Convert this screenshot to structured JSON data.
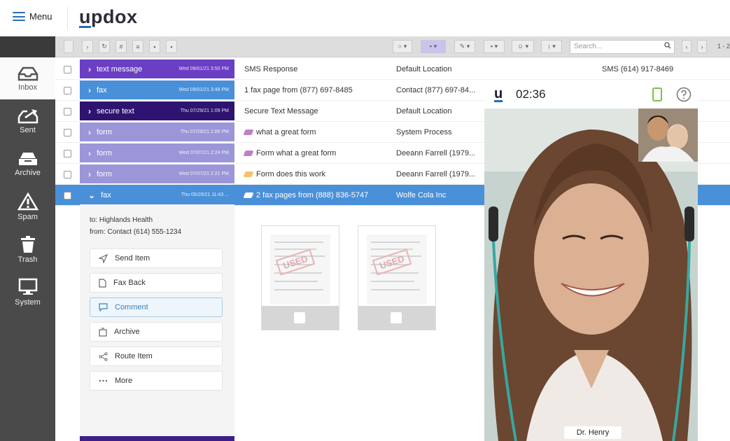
{
  "header": {
    "menu_label": "Menu",
    "logo_pre": "u",
    "logo_rest": "pdox"
  },
  "sidebar": [
    {
      "label": "Inbox",
      "icon": "inbox-icon",
      "active": true
    },
    {
      "label": "Sent",
      "icon": "sent-icon"
    },
    {
      "label": "Archive",
      "icon": "archive-icon"
    },
    {
      "label": "Spam",
      "icon": "spam-icon"
    },
    {
      "label": "Trash",
      "icon": "trash-icon"
    },
    {
      "label": "System",
      "icon": "system-icon"
    }
  ],
  "toolbar": {
    "search_placeholder": "Search...",
    "pager": "1 - 2"
  },
  "rows": [
    {
      "type": "text message",
      "date": "Wed 09/01/21 3:50 PM",
      "color": "#6a3fc4",
      "subject": "SMS Response",
      "from": "Default Location",
      "extra": "SMS (614) 917-8469",
      "tag": ""
    },
    {
      "type": "fax",
      "date": "Wed 09/01/21 3:48 PM",
      "color": "#4a90d9",
      "subject": "1 fax page from (877) 697-8485",
      "from": "Contact (877) 697-84...",
      "extra": "",
      "tag": ""
    },
    {
      "type": "secure text",
      "date": "Thu 07/29/21 1:09 PM",
      "color": "#2e1470",
      "subject": "Secure Text Message",
      "from": "Default Location",
      "extra": "",
      "tag": ""
    },
    {
      "type": "form",
      "date": "Thu 07/29/21 1:06 PM",
      "color": "#9b96d8",
      "subject": "what a great form",
      "from": "System Process",
      "extra": "",
      "tag": "#c17fc7"
    },
    {
      "type": "form",
      "date": "Wed 07/07/21 2:24 PM",
      "color": "#9b96d8",
      "subject": "Form what a great form",
      "from": "Deeann Farrell (1979...",
      "extra": "",
      "tag": "#c17fc7"
    },
    {
      "type": "form",
      "date": "Wed 07/07/21 2:21 PM",
      "color": "#9b96d8",
      "subject": "Form does this work",
      "from": "Deeann Farrell (1979...",
      "extra": "",
      "tag": "#f5c16c"
    },
    {
      "type": "fax",
      "date": "Thu 05/20/21 11:43 ...",
      "color": "#4a90d9",
      "subject": "2 fax pages from (888) 836-5747",
      "from": "Wolfe Cola Inc",
      "extra": "",
      "tag": "#ffffff",
      "selected": true
    }
  ],
  "detail": {
    "to": "to: Highlands Health",
    "from": "from: Contact (614) 555-1234",
    "actions": [
      {
        "label": "Send Item",
        "icon": "send-icon"
      },
      {
        "label": "Fax Back",
        "icon": "document-icon"
      },
      {
        "label": "Comment",
        "icon": "comment-icon",
        "highlighted": true
      },
      {
        "label": "Archive",
        "icon": "archive-box-icon"
      },
      {
        "label": "Route Item",
        "icon": "share-icon"
      },
      {
        "label": "More",
        "icon": "more-icon"
      }
    ],
    "stamps": [
      "USED",
      "USED"
    ]
  },
  "call": {
    "logo": "u",
    "time": "02:36",
    "caller": "Dr. Henry"
  },
  "colors": {
    "accent": "#4a90d9",
    "sidebar": "#4a4a4a",
    "purple_text": "#6a3fc4",
    "secure_text": "#2e1470",
    "form": "#9b96d8"
  }
}
